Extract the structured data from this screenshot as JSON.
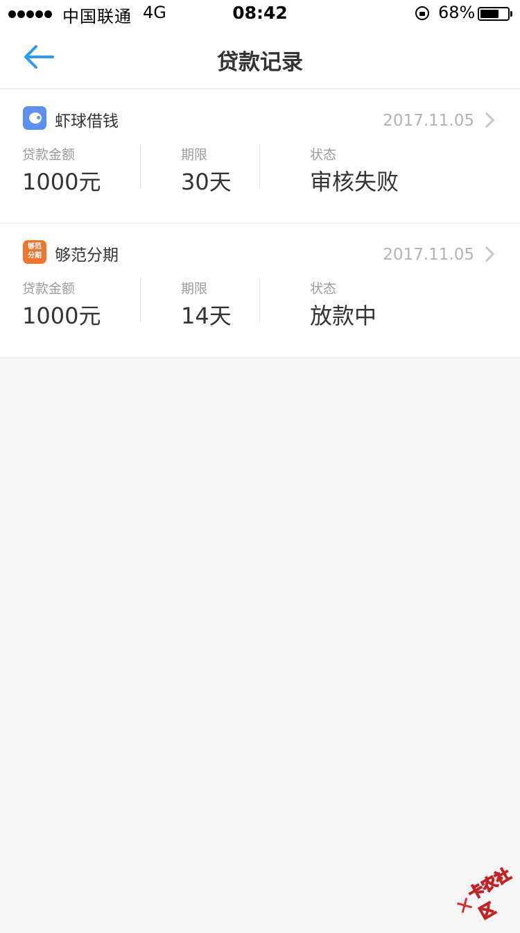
{
  "status_bar": {
    "carrier": "中国联通",
    "network": "4G",
    "time": "08:42",
    "battery": "68%",
    "battery_level": 0.68
  },
  "header": {
    "title": "贷款记录"
  },
  "loans": [
    {
      "app_name": "虾球借钱",
      "logo_icon": "shrimp-app-icon",
      "date": "2017.11.05",
      "amount_label": "贷款金额",
      "amount": "1000元",
      "term_label": "期限",
      "term": "30天",
      "status_label": "状态",
      "status": "审核失败"
    },
    {
      "app_name": "够范分期",
      "logo_icon": "goufan-app-icon",
      "logo_text_top": "够范",
      "logo_text_bottom": "分期",
      "date": "2017.11.05",
      "amount_label": "贷款金额",
      "amount": "1000元",
      "term_label": "期限",
      "term": "14天",
      "status_label": "状态",
      "status": "放款中"
    }
  ],
  "watermark": {
    "text": "卡农社区"
  },
  "colors": {
    "accent": "#2b9bf0",
    "background": "#f7f7f7",
    "muted": "#9b9b9b"
  }
}
